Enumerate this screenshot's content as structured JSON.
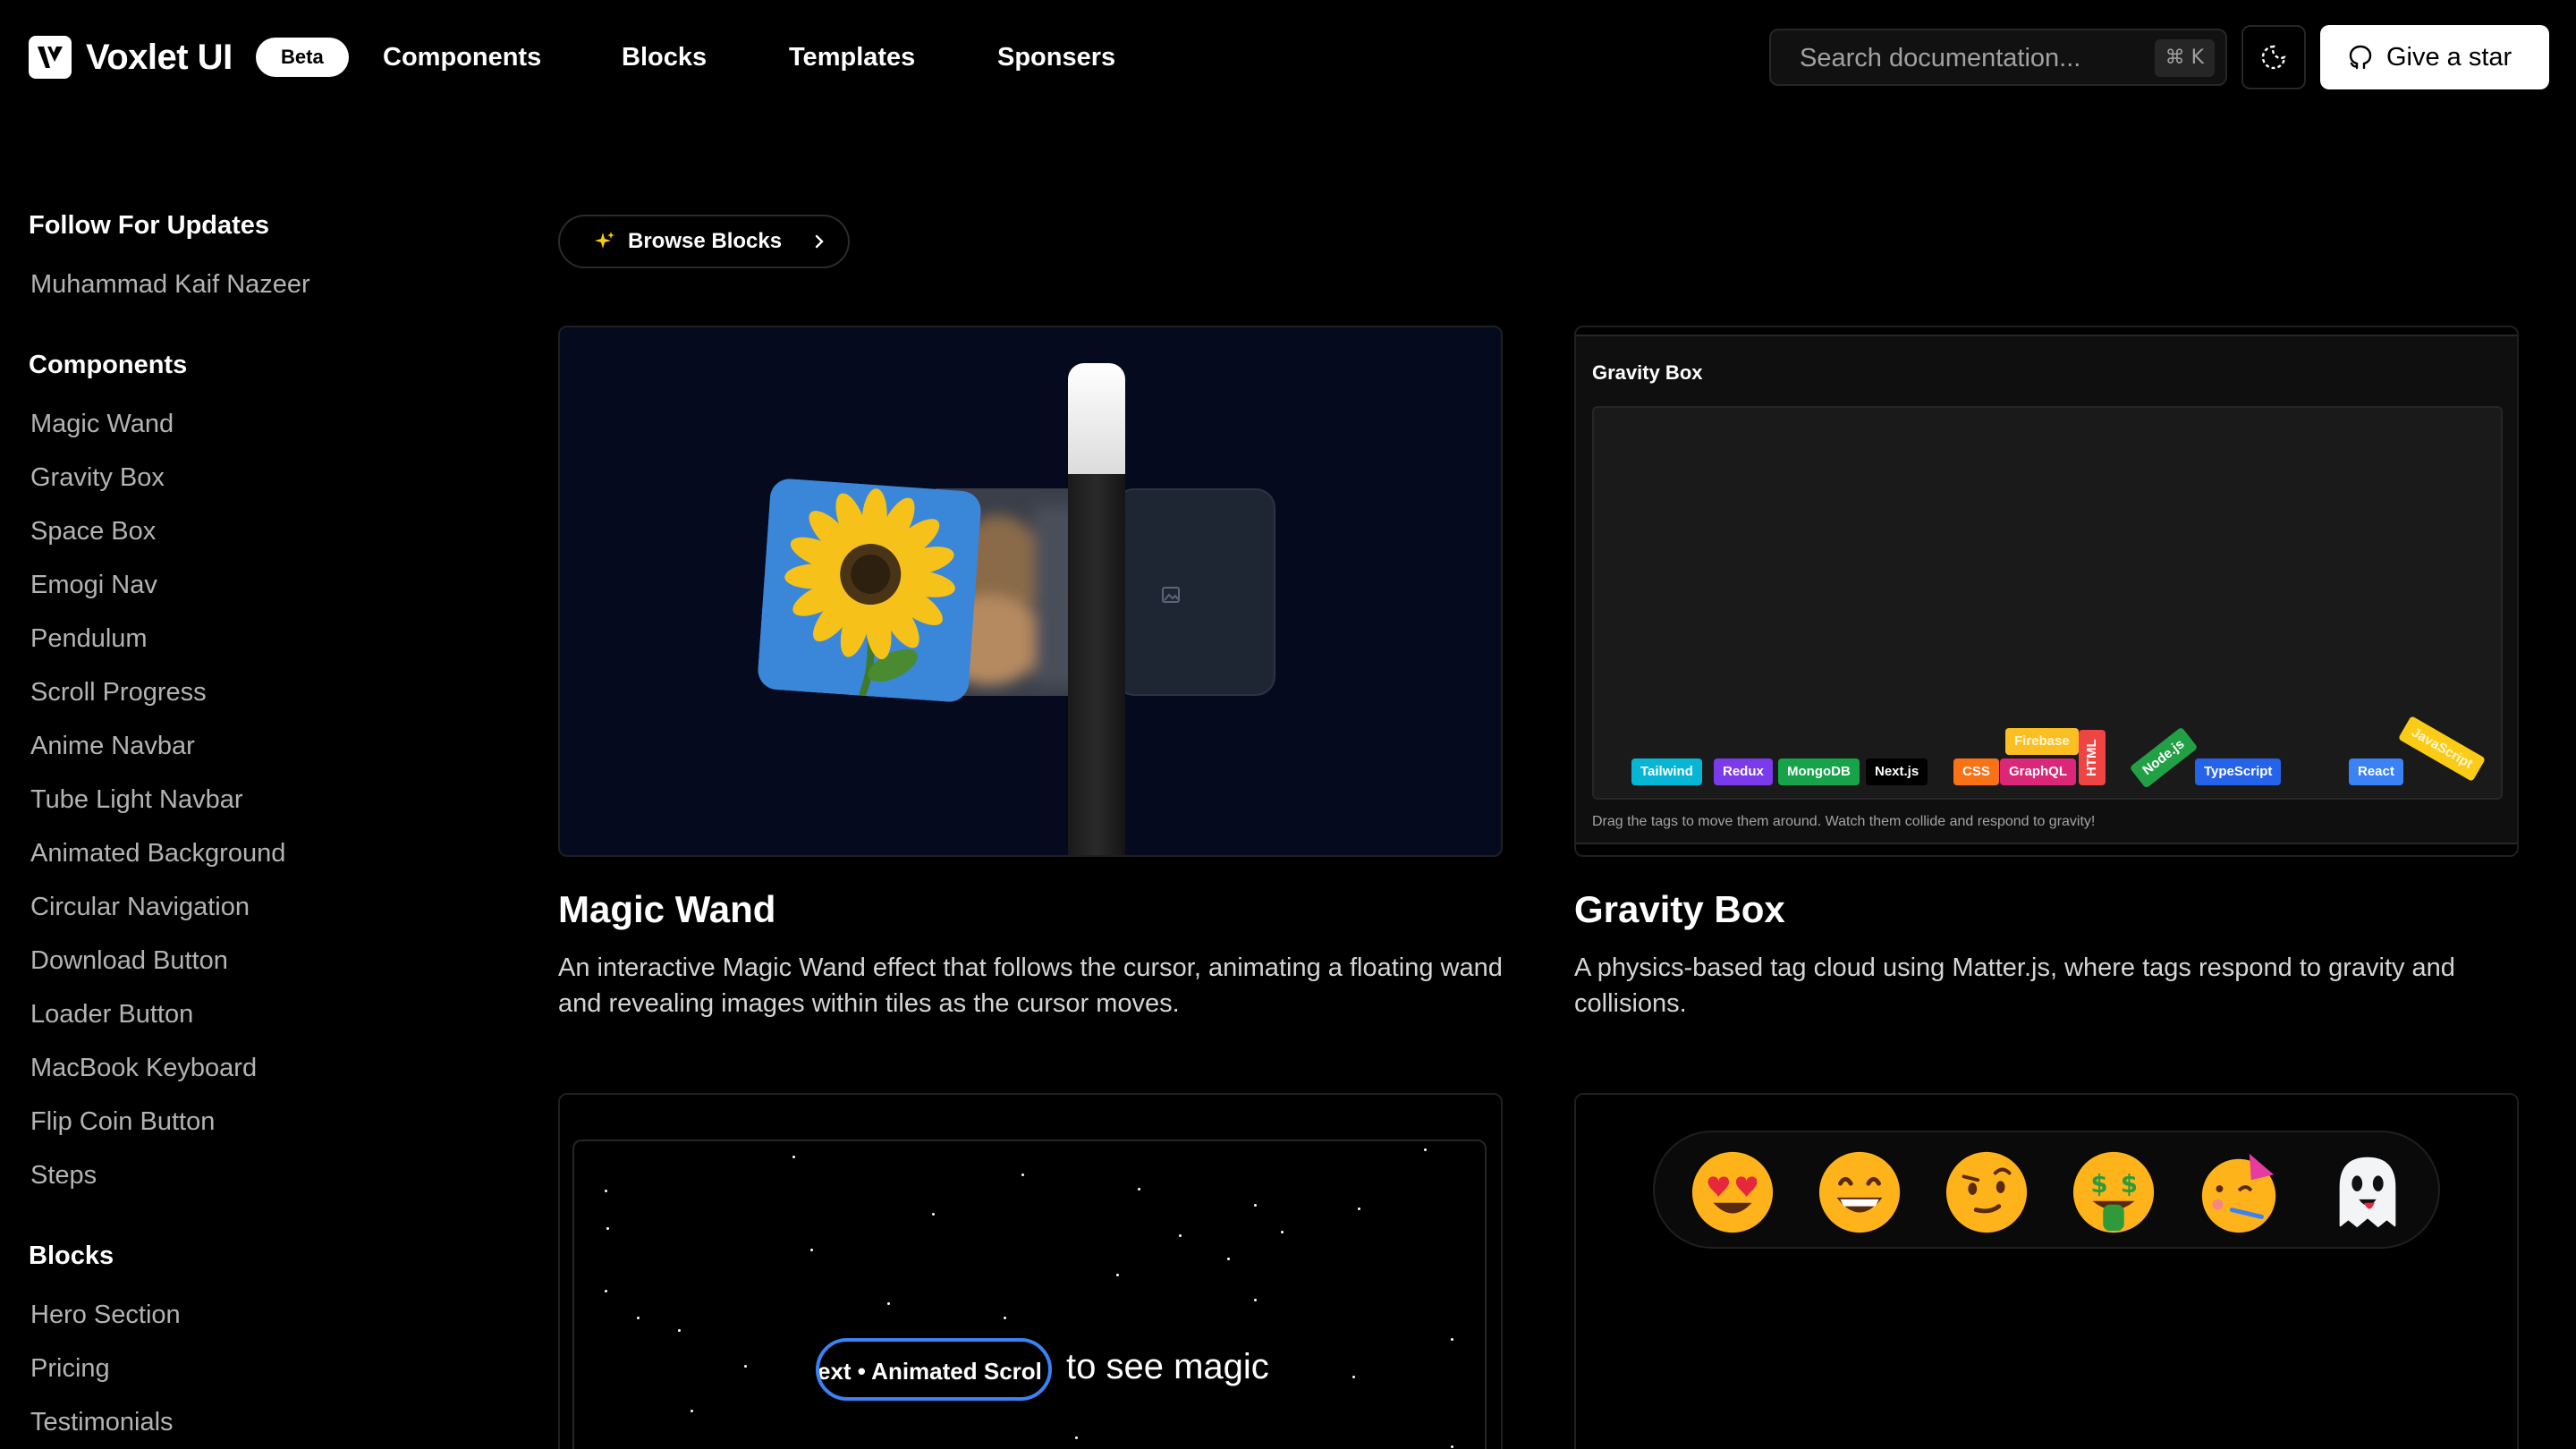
{
  "header": {
    "brand": "Voxlet UI",
    "badge": "Beta",
    "nav": [
      "Components",
      "Blocks",
      "Templates",
      "Sponsers"
    ],
    "search_placeholder": "Search documentation...",
    "search_shortcut": "⌘ K",
    "star_label": "Give a star"
  },
  "sidebar": {
    "follow_heading": "Follow For Updates",
    "follow_item": "Muhammad Kaif Nazeer",
    "components_heading": "Components",
    "components": [
      "Magic Wand",
      "Gravity Box",
      "Space Box",
      "Emogi Nav",
      "Pendulum",
      "Scroll Progress",
      "Anime Navbar",
      "Tube Light Navbar",
      "Animated Background",
      "Circular Navigation",
      "Download Button",
      "Loader Button",
      "MacBook Keyboard",
      "Flip Coin Button",
      "Steps"
    ],
    "blocks_heading": "Blocks",
    "blocks": [
      "Hero Section",
      "Pricing",
      "Testimonials"
    ]
  },
  "main": {
    "browse_label": "Browse Blocks",
    "cards": [
      {
        "title": "Magic Wand",
        "desc": "An interactive Magic Wand effect that follows the cursor, animating a floating wand and revealing images within tiles as the cursor moves."
      },
      {
        "title": "Gravity Box",
        "desc": "A physics-based tag cloud using Matter.js, where tags respond to gravity and collisions."
      }
    ],
    "gravity_demo": {
      "title": "Gravity Box",
      "hint": "Drag the tags to move them around. Watch them collide and respond to gravity!",
      "tags": [
        "Tailwind",
        "Redux",
        "MongoDB",
        "Next.js",
        "CSS",
        "GraphQL",
        "Firebase",
        "HTML",
        "Node.js",
        "TypeScript",
        "React",
        "JavaScript"
      ]
    },
    "scroll_demo": {
      "pill_text": "ext • Animated Scrol",
      "rest_text": "to see magic"
    },
    "emoji_nav": {
      "emojis": [
        "heart-eyes",
        "grinning",
        "face-with-raised-eyebrow",
        "money-mouth",
        "partying",
        "ghost"
      ]
    }
  }
}
